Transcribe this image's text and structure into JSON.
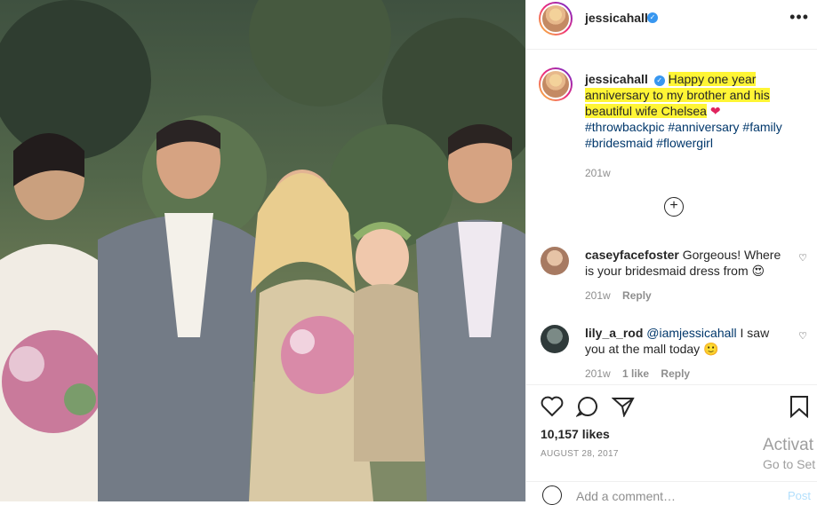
{
  "post_header": {
    "username": "jessicahall",
    "verified_icon": "verified-badge-icon",
    "more_icon": "more-options-icon"
  },
  "caption": {
    "username": "jessicahall",
    "highlighted_text": "Happy one year anniversary to my brother and his beautiful wife Chelsea",
    "heart_icon": "red-heart-emoji",
    "hashtags": "#throwbackpic #anniversary #family #bridesmaid #flowergirl",
    "age": "201w"
  },
  "add_icon": "plus-circle-icon",
  "comments": [
    {
      "username": "caseyfacefoster",
      "text": "Gorgeous! Where is your bridesmaid dress from",
      "emoji": "heart-eyes-emoji",
      "age": "201w",
      "reply": "Reply",
      "likes": ""
    },
    {
      "username": "lily_a_rod",
      "mention": "@iamjessicahall",
      "text": "I saw you at the mall today",
      "emoji": "smiley-emoji",
      "age": "201w",
      "likes": "1 like",
      "reply": "Reply"
    }
  ],
  "actions": {
    "like_icon": "heart-icon",
    "comment_icon": "comment-icon",
    "share_icon": "share-icon",
    "save_icon": "bookmark-icon",
    "likes": "10,157 likes",
    "date": "AUGUST 28, 2017"
  },
  "add_comment": {
    "placeholder": "Add a comment…",
    "post_label": "Post",
    "emoji_icon": "emoji-smile-icon"
  },
  "watermark": {
    "line1": "Activat",
    "line2": "Go to Set"
  },
  "colors": {
    "link": "#00376b",
    "highlight": "#fff535",
    "verified": "#3897f0",
    "muted": "#8e8e8e",
    "post_disabled": "#b2dffc"
  }
}
